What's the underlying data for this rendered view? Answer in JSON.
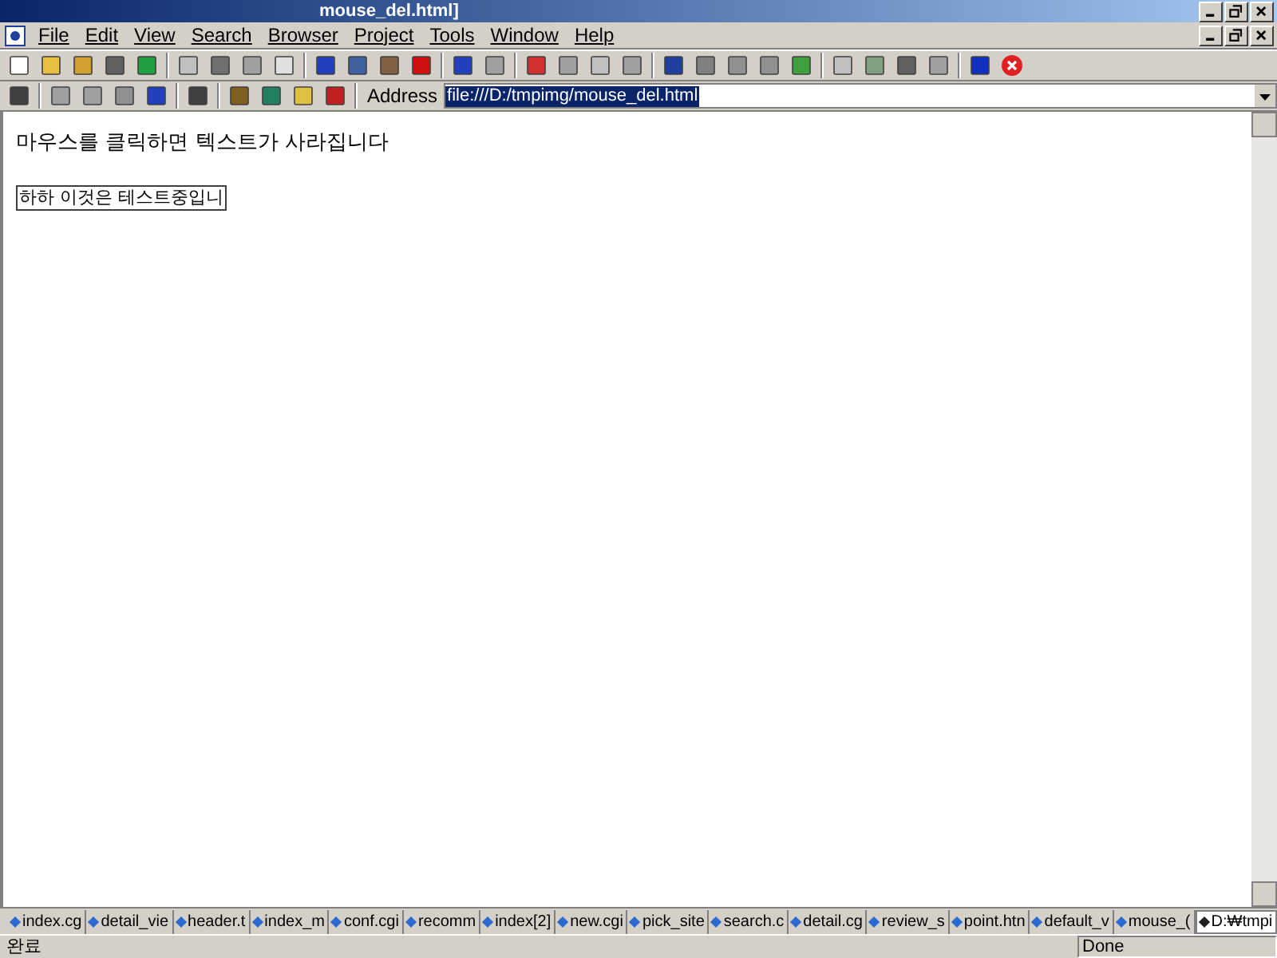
{
  "window": {
    "title": "mouse_del.html]"
  },
  "menu": [
    {
      "label": "File"
    },
    {
      "label": "Edit"
    },
    {
      "label": "View"
    },
    {
      "label": "Search"
    },
    {
      "label": "Browser"
    },
    {
      "label": "Project"
    },
    {
      "label": "Tools"
    },
    {
      "label": "Window"
    },
    {
      "label": "Help"
    }
  ],
  "address_bar": {
    "label": "Address",
    "value": "file:///D:/tmpimg/mouse_del.html",
    "selected": true
  },
  "page": {
    "heading": "마우스를 클릭하면 텍스트가 사라집니다",
    "input_value": "하하 이것은 테스트중입니"
  },
  "document_tabs": [
    {
      "label": "index.cg",
      "selected": false
    },
    {
      "label": "detail_vie",
      "selected": false
    },
    {
      "label": "header.t",
      "selected": false
    },
    {
      "label": "index_m",
      "selected": false
    },
    {
      "label": "conf.cgi",
      "selected": false
    },
    {
      "label": "recomm",
      "selected": false
    },
    {
      "label": "index[2]",
      "selected": false
    },
    {
      "label": "new.cgi",
      "selected": false
    },
    {
      "label": "pick_site",
      "selected": false
    },
    {
      "label": "search.c",
      "selected": false
    },
    {
      "label": "detail.cg",
      "selected": false
    },
    {
      "label": "review_s",
      "selected": false
    },
    {
      "label": "point.htn",
      "selected": false
    },
    {
      "label": "default_v",
      "selected": false
    },
    {
      "label": "mouse_(",
      "selected": false
    },
    {
      "label": "D:₩tmpi",
      "selected": true
    }
  ],
  "status_bar": {
    "left": "완료",
    "right": "Done"
  }
}
